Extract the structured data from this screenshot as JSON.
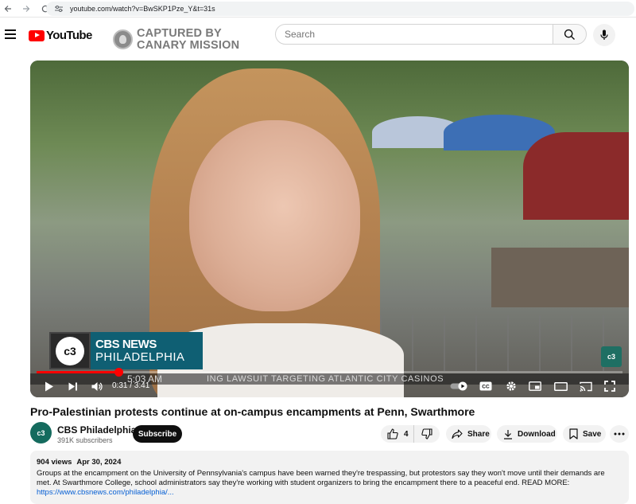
{
  "browser": {
    "url": "youtube.com/watch?v=BwSKP1Pze_Y&t=31s"
  },
  "header": {
    "logo_text": "YouTube",
    "overlay_line1": "CAPTURED BY",
    "overlay_line2": "CANARY MISSION",
    "search_placeholder": "Search"
  },
  "player": {
    "lower_third_logo": "c3",
    "lower_third_line1": "CBS NEWS",
    "lower_third_line2": "PHILADELPHIA",
    "ticker_time": "5:03 AM",
    "ticker_text": "ING LAWSUIT TARGETING ATLANTIC CITY CASINOS",
    "corner_bug": "c3",
    "time_display": "0:31 / 3:41",
    "progress_fraction": 0.14,
    "accent_color": "#ff0000"
  },
  "video": {
    "title": "Pro-Palestinian protests continue at on-campus encampments at Penn, Swarthmore"
  },
  "channel": {
    "avatar_text": "c3",
    "name": "CBS Philadelphia",
    "subscribers": "391K subscribers",
    "subscribe_label": "Subscribe"
  },
  "actions": {
    "like_count": "4",
    "share_label": "Share",
    "download_label": "Download",
    "save_label": "Save"
  },
  "description": {
    "views": "904 views",
    "date": "Apr 30, 2024",
    "text": "Groups at the encampment on the University of Pennsylvania's campus have been warned they're trespassing, but protestors say they won't move until their demands are met. At Swarthmore College, school administrators say they're working with student organizers to bring the encampment there to a peaceful end. READ MORE:",
    "link": "https://www.cbsnews.com/philadelphia/..."
  }
}
